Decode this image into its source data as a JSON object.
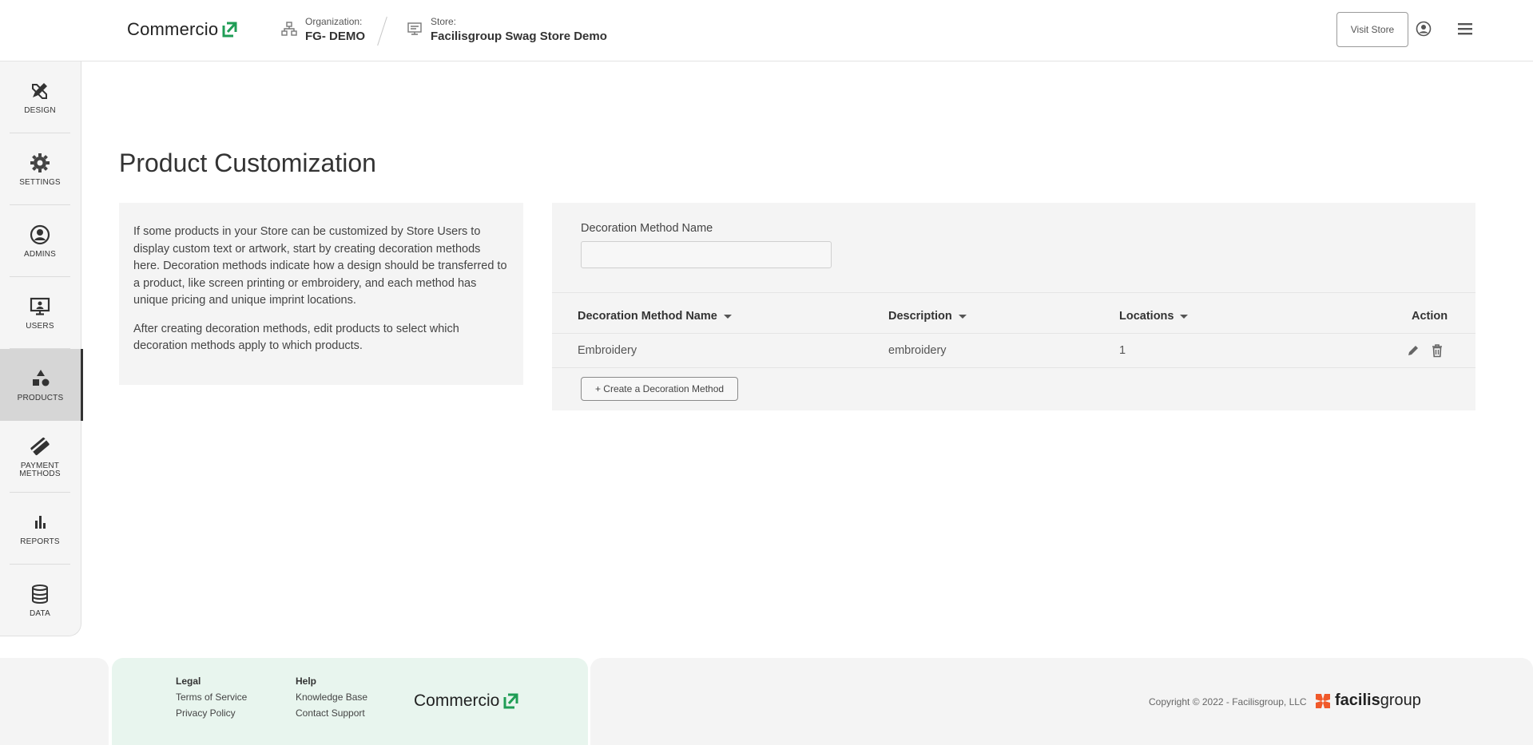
{
  "header": {
    "logo_text": "Commercio",
    "org_label": "Organization:",
    "org_value": "FG- DEMO",
    "store_label": "Store:",
    "store_value": "Facilisgroup Swag Store Demo",
    "visit_store": "Visit Store"
  },
  "sidebar": {
    "items": [
      {
        "label": "DESIGN",
        "icon": "design-icon"
      },
      {
        "label": "SETTINGS",
        "icon": "gear-icon"
      },
      {
        "label": "ADMINS",
        "icon": "admin-user-icon"
      },
      {
        "label": "USERS",
        "icon": "users-monitor-icon"
      },
      {
        "label": "PRODUCTS",
        "icon": "shapes-icon",
        "active": true
      },
      {
        "label": "PAYMENT METHODS",
        "icon": "payment-card-icon"
      },
      {
        "label": "REPORTS",
        "icon": "bar-chart-icon"
      },
      {
        "label": "DATA",
        "icon": "database-icon"
      }
    ]
  },
  "main": {
    "title": "Product Customization",
    "info_p1": "If some products in your Store can be customized by Store Users to display custom text or artwork, start by creating decoration methods here. Decoration methods indicate how a design should be transferred to a product, like screen printing or embroidery, and each method has unique pricing and unique imprint locations.",
    "info_p2": "After creating decoration methods, edit products to select which decoration methods apply to which products.",
    "filter_label": "Decoration Method Name",
    "filter_value": "",
    "table": {
      "columns": [
        "Decoration Method Name",
        "Description",
        "Locations",
        "Action"
      ],
      "rows": [
        {
          "name": "Embroidery",
          "description": "embroidery",
          "locations": "1"
        }
      ]
    },
    "create_button": "+ Create a Decoration Method"
  },
  "footer": {
    "legal_heading": "Legal",
    "terms": "Terms of Service",
    "privacy": "Privacy Policy",
    "help_heading": "Help",
    "knowledge": "Knowledge Base",
    "contact": "Contact Support",
    "logo_text": "Commercio",
    "copyright": "Copyright © 2022 - Facilisgroup, LLC",
    "fg_logo_prefix": "facilis",
    "fg_logo_suffix": "group"
  },
  "colors": {
    "brand_green": "#1f9d55",
    "fg_orange": "#f0592a"
  }
}
